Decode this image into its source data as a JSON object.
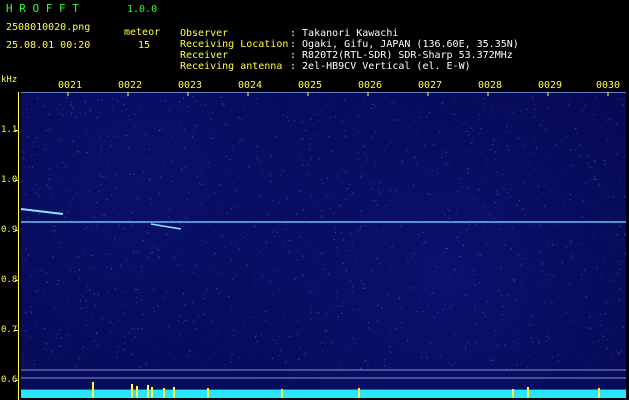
{
  "app": {
    "name": "H R O F F T",
    "version": "1.0.0"
  },
  "file": {
    "name": "2508010020.png",
    "datetime": "25.08.01 00:20"
  },
  "meteor": {
    "label": "meteor",
    "count": "15"
  },
  "info": [
    {
      "label": "Observer",
      "value": ": Takanori Kawachi"
    },
    {
      "label": "Receiving Location",
      "value": ": Ogaki, Gifu, JAPAN (136.60E, 35.35N)"
    },
    {
      "label": "Receiver",
      "value": ": R820T2(RTL-SDR) SDR-Sharp 53.372MHz"
    },
    {
      "label": "Receiving antenna",
      "value": ": 2el-HB9CV Vertical (el. E-W)"
    }
  ],
  "axis": {
    "y_unit": "kHz",
    "y_ticks": [
      "1.1",
      "1.0",
      "0.9",
      "0.8",
      "0.7",
      "0.6"
    ],
    "x_ticks": [
      "0021",
      "0022",
      "0023",
      "0024",
      "0025",
      "0026",
      "0027",
      "0028",
      "0029",
      "0030"
    ]
  },
  "colors": {
    "background": "#060a54",
    "label": "#ffff3a",
    "title": "#2cff2c",
    "signal": "#8ad8ff",
    "meter": "#27e6ff"
  },
  "signal": {
    "carrier_khz": 0.915,
    "meteor_traces_minutes": [
      0.0,
      1.2
    ]
  }
}
